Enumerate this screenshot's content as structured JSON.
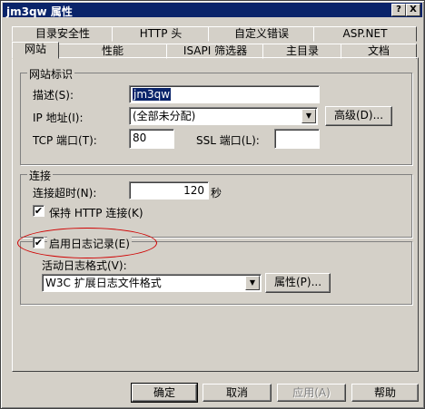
{
  "window": {
    "title": "jm3qw 属性"
  },
  "title_buttons": {
    "help": "?",
    "close": "X"
  },
  "tabs_row1": [
    "目录安全性",
    "HTTP 头",
    "自定义错误",
    "ASP.NET"
  ],
  "tabs_row2": [
    "网站",
    "性能",
    "ISAPI 筛选器",
    "主目录",
    "文档"
  ],
  "site_id": {
    "legend": "网站标识",
    "description_label": "描述(S):",
    "description_value": "jm3qw",
    "ip_label": "IP 地址(I):",
    "ip_value": "(全部未分配)",
    "advanced_button": "高级(D)...",
    "tcp_label": "TCP 端口(T):",
    "tcp_value": "80",
    "ssl_label": "SSL 端口(L):",
    "ssl_value": ""
  },
  "connection": {
    "legend": "连接",
    "timeout_label": "连接超时(N):",
    "timeout_value": "120",
    "timeout_unit": "秒",
    "keepalive_label": "保持 HTTP 连接(K)",
    "keepalive_checked": "✔"
  },
  "logging": {
    "enable_label": "启用日志记录(E)",
    "enable_checked": "✔",
    "format_label": "活动日志格式(V):",
    "format_value": "W3C 扩展日志文件格式",
    "properties_button": "属性(P)..."
  },
  "footer": {
    "ok": "确定",
    "cancel": "取消",
    "apply": "应用(A)",
    "help": "帮助"
  }
}
